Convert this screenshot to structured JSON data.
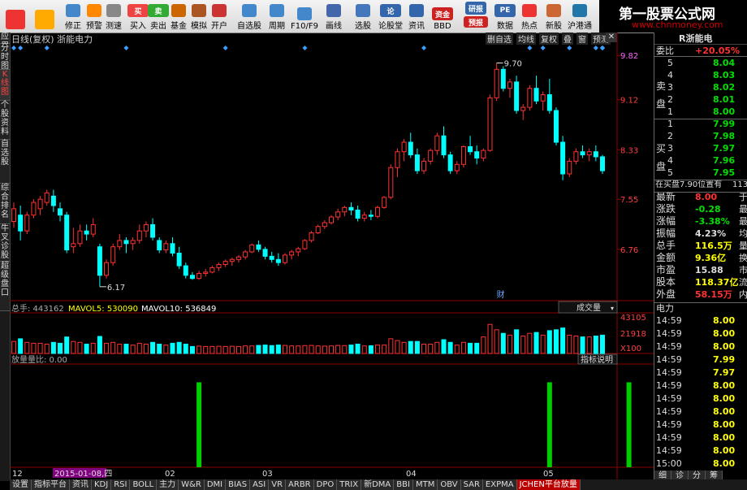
{
  "toolbar": {
    "buttons": [
      {
        "label": "",
        "icon": "grid-icon"
      },
      {
        "label": "",
        "icon": "back-arrow-icon"
      },
      {
        "label": "修正",
        "icon": "up-down-icon"
      },
      {
        "label": "预警",
        "icon": "alarm-icon"
      },
      {
        "label": "测速",
        "icon": "clock-icon"
      },
      {
        "label": "买入",
        "icon": "buy-icon",
        "glyph": "买"
      },
      {
        "label": "卖出",
        "icon": "sell-icon",
        "glyph": "卖"
      },
      {
        "label": "基金",
        "icon": "fund-icon"
      },
      {
        "label": "模拟",
        "icon": "gavel-icon"
      },
      {
        "label": "开户",
        "icon": "account-icon"
      },
      {
        "label": "自选股",
        "icon": "portfolio-icon"
      },
      {
        "label": "周期",
        "icon": "period-icon"
      },
      {
        "label": "F10/F9",
        "icon": "f10-icon"
      },
      {
        "label": "画线",
        "icon": "pen-icon"
      },
      {
        "label": "选股",
        "icon": "select-icon"
      },
      {
        "label": "论股堂",
        "icon": "forum-icon",
        "glyph": "论"
      },
      {
        "label": "资讯",
        "icon": "news-icon"
      },
      {
        "label": "BBD",
        "icon": "fund-flow-icon",
        "glyph": "资金"
      },
      {
        "label": "",
        "icon": "research-icon",
        "glyph": "研报"
      },
      {
        "label": "",
        "icon": "limit-icon",
        "glyph": "预报"
      },
      {
        "label": "数据",
        "icon": "pe-icon",
        "glyph": "PE"
      },
      {
        "label": "热点",
        "icon": "hot-icon"
      },
      {
        "label": "新股",
        "icon": "new-stock-icon"
      },
      {
        "label": "沪港通",
        "icon": "hk-connect-icon"
      }
    ]
  },
  "brand": {
    "title": "第一股票公式网",
    "url": "www.chnmoney.com"
  },
  "left_tabs": [
    "应用",
    "分时图",
    "K线图",
    "个股资料",
    "自选股",
    "综合排名",
    "牛叉诊股",
    "超级盘口"
  ],
  "chart": {
    "title": "日线(复权) 浙能电力",
    "header_buttons": [
      "删自选",
      "均线",
      "复权",
      "叠",
      "窗",
      "预测"
    ],
    "close_glyph": "✕",
    "price_labels": [
      "9.82",
      "9.12",
      "8.33",
      "7.55",
      "6.76"
    ],
    "high_label": "9.70",
    "low_label": "6.17",
    "event_label": "财",
    "candles": [
      [
        7.2,
        7.5,
        7.1,
        7.4
      ],
      [
        7.3,
        7.45,
        6.9,
        7.05
      ],
      [
        7.05,
        7.35,
        7.0,
        7.3
      ],
      [
        7.3,
        7.55,
        7.25,
        7.5
      ],
      [
        7.4,
        7.6,
        7.3,
        7.55
      ],
      [
        7.5,
        7.7,
        7.45,
        7.65
      ],
      [
        7.6,
        7.7,
        7.35,
        7.45
      ],
      [
        7.4,
        7.5,
        7.2,
        7.3
      ],
      [
        7.3,
        7.35,
        6.7,
        6.75
      ],
      [
        6.8,
        7.1,
        6.7,
        6.85
      ],
      [
        6.85,
        7.15,
        6.8,
        7.05
      ],
      [
        7.05,
        7.15,
        6.9,
        7.0
      ],
      [
        7.0,
        7.25,
        6.95,
        7.15
      ],
      [
        6.8,
        6.85,
        6.17,
        6.35
      ],
      [
        6.35,
        6.6,
        6.3,
        6.55
      ],
      [
        6.55,
        6.85,
        6.5,
        6.8
      ],
      [
        6.8,
        7.0,
        6.75,
        6.9
      ],
      [
        6.9,
        6.95,
        6.7,
        6.85
      ],
      [
        6.85,
        6.95,
        6.75,
        6.9
      ],
      [
        6.9,
        7.15,
        6.85,
        7.05
      ],
      [
        7.05,
        7.2,
        6.95,
        7.15
      ],
      [
        7.15,
        7.25,
        6.9,
        6.95
      ],
      [
        6.9,
        6.95,
        6.7,
        6.75
      ],
      [
        6.75,
        6.9,
        6.7,
        6.85
      ],
      [
        6.85,
        6.95,
        6.65,
        6.7
      ],
      [
        6.7,
        6.8,
        6.45,
        6.5
      ],
      [
        6.5,
        6.55,
        6.3,
        6.35
      ],
      [
        6.35,
        6.4,
        6.28,
        6.3
      ],
      [
        6.3,
        6.42,
        6.28,
        6.38
      ],
      [
        6.38,
        6.45,
        6.33,
        6.4
      ],
      [
        6.4,
        6.5,
        6.38,
        6.47
      ],
      [
        6.47,
        6.55,
        6.42,
        6.52
      ],
      [
        6.52,
        6.6,
        6.48,
        6.57
      ],
      [
        6.57,
        6.63,
        6.5,
        6.6
      ],
      [
        6.6,
        6.67,
        6.55,
        6.64
      ],
      [
        6.64,
        6.75,
        6.6,
        6.72
      ],
      [
        6.72,
        6.85,
        6.7,
        6.83
      ],
      [
        6.83,
        6.9,
        6.72,
        6.76
      ],
      [
        6.76,
        6.8,
        6.6,
        6.65
      ],
      [
        6.65,
        6.72,
        6.55,
        6.6
      ],
      [
        6.6,
        6.7,
        6.5,
        6.55
      ],
      [
        6.55,
        6.7,
        6.52,
        6.67
      ],
      [
        6.67,
        6.75,
        6.6,
        6.72
      ],
      [
        6.72,
        6.8,
        6.65,
        6.77
      ],
      [
        6.77,
        6.92,
        6.75,
        6.9
      ],
      [
        6.9,
        7.05,
        6.87,
        7.02
      ],
      [
        7.02,
        7.15,
        7.0,
        7.12
      ],
      [
        7.12,
        7.22,
        7.08,
        7.18
      ],
      [
        7.18,
        7.3,
        7.15,
        7.27
      ],
      [
        7.27,
        7.4,
        7.22,
        7.35
      ],
      [
        7.35,
        7.45,
        7.28,
        7.42
      ],
      [
        7.42,
        7.5,
        7.3,
        7.38
      ],
      [
        7.38,
        7.45,
        7.2,
        7.25
      ],
      [
        7.25,
        7.35,
        7.2,
        7.3
      ],
      [
        7.3,
        7.38,
        7.22,
        7.28
      ],
      [
        7.28,
        7.45,
        7.25,
        7.42
      ],
      [
        7.42,
        7.6,
        7.4,
        7.58
      ],
      [
        7.58,
        8.1,
        7.55,
        8.05
      ],
      [
        8.05,
        8.35,
        7.9,
        8.3
      ],
      [
        8.3,
        8.5,
        8.15,
        8.45
      ],
      [
        8.45,
        8.6,
        8.2,
        8.25
      ],
      [
        8.25,
        8.35,
        7.95,
        8.0
      ],
      [
        8.0,
        8.2,
        7.95,
        8.15
      ],
      [
        8.15,
        8.35,
        8.1,
        8.32
      ],
      [
        8.32,
        8.6,
        8.25,
        8.55
      ],
      [
        8.55,
        8.7,
        8.2,
        8.25
      ],
      [
        8.25,
        8.3,
        7.95,
        8.0
      ],
      [
        8.0,
        8.15,
        7.95,
        8.1
      ],
      [
        8.1,
        8.4,
        8.05,
        8.38
      ],
      [
        8.38,
        8.55,
        8.25,
        8.3
      ],
      [
        8.3,
        8.4,
        8.1,
        8.2
      ],
      [
        8.2,
        8.35,
        8.15,
        8.32
      ],
      [
        8.32,
        9.2,
        8.3,
        9.15
      ],
      [
        9.15,
        9.7,
        9.1,
        9.6
      ],
      [
        9.6,
        9.65,
        9.25,
        9.3
      ],
      [
        9.3,
        9.45,
        9.15,
        9.4
      ],
      [
        9.4,
        9.5,
        8.9,
        8.95
      ],
      [
        8.95,
        9.05,
        8.8,
        9.0
      ],
      [
        9.0,
        9.35,
        8.95,
        9.3
      ],
      [
        9.3,
        9.5,
        9.05,
        9.1
      ],
      [
        9.1,
        9.25,
        8.95,
        9.2
      ],
      [
        9.2,
        9.45,
        8.9,
        8.95
      ],
      [
        8.95,
        9.0,
        8.4,
        8.45
      ],
      [
        8.45,
        8.55,
        7.85,
        7.95
      ],
      [
        7.95,
        8.2,
        7.9,
        8.15
      ],
      [
        8.15,
        8.35,
        8.1,
        8.3
      ],
      [
        8.3,
        8.4,
        8.2,
        8.25
      ],
      [
        8.25,
        8.35,
        8.15,
        8.3
      ],
      [
        8.3,
        8.4,
        8.15,
        8.22
      ],
      [
        8.22,
        8.25,
        7.95,
        8.0
      ]
    ],
    "volume": {
      "label_main": "总手: 443162",
      "label_ma5": "MAVOL5: 530090",
      "label_ma10": "MAVOL10: 536849",
      "dropdown": "成交量",
      "axis_labels": [
        "43105",
        "21918",
        "X100"
      ]
    },
    "indicator": {
      "label": "放量量比: 0.00",
      "button": "指标说明",
      "spikes": [
        {
          "i": 28,
          "v": 1.0
        },
        {
          "i": 81,
          "v": 1.0
        },
        {
          "i": 93,
          "v": 1.0
        }
      ]
    },
    "date_labels": [
      "12",
      "2015-01-08,四",
      "02",
      "03",
      "04",
      "05"
    ]
  },
  "right_panel": {
    "name": "R浙能电",
    "weibi_label": "委比",
    "weibi_value": "+20.05%",
    "sell_label": "卖盘",
    "sells": [
      [
        "5",
        "8.04"
      ],
      [
        "4",
        "8.03"
      ],
      [
        "3",
        "8.02"
      ],
      [
        "2",
        "8.01"
      ],
      [
        "1",
        "8.00"
      ]
    ],
    "buy_label": "买盘",
    "buys": [
      [
        "1",
        "7.99"
      ],
      [
        "2",
        "7.98"
      ],
      [
        "3",
        "7.97"
      ],
      [
        "4",
        "7.96"
      ],
      [
        "5",
        "7.95"
      ]
    ],
    "position_line": "在买盘7.90位置有",
    "position_suffix": "113",
    "stats": [
      {
        "k": "最新",
        "v": "8.00",
        "s": "于",
        "c": "red"
      },
      {
        "k": "涨跌",
        "v": "-0.28",
        "s": "最",
        "c": "grn"
      },
      {
        "k": "涨幅",
        "v": "-3.38%",
        "s": "最",
        "c": "grn"
      },
      {
        "k": "振幅",
        "v": "4.23%",
        "s": "均",
        "c": "wht"
      },
      {
        "k": "总手",
        "v": "116.5万",
        "s": "量",
        "c": "yel"
      },
      {
        "k": "金额",
        "v": "9.36亿",
        "s": "换",
        "c": "yel"
      },
      {
        "k": "市盈",
        "v": "15.88",
        "s": "市",
        "c": "wht"
      },
      {
        "k": "股本",
        "v": "118.37亿",
        "s": "流",
        "c": "yel"
      },
      {
        "k": "外盘",
        "v": "58.15万",
        "s": "内",
        "c": "red"
      }
    ],
    "ticks_header": "电力",
    "ticks": [
      [
        "14:59",
        "8.00"
      ],
      [
        "14:59",
        "8.00"
      ],
      [
        "14:59",
        "8.00"
      ],
      [
        "14:59",
        "7.99"
      ],
      [
        "14:59",
        "7.97"
      ],
      [
        "14:59",
        "8.00"
      ],
      [
        "14:59",
        "8.00"
      ],
      [
        "14:59",
        "8.00"
      ],
      [
        "14:59",
        "8.00"
      ],
      [
        "14:59",
        "8.00"
      ],
      [
        "14:59",
        "8.00"
      ],
      [
        "15:00",
        "8.00"
      ]
    ],
    "bottom_tabs": [
      "细",
      "诊",
      "分",
      "筹"
    ]
  },
  "bottom_tabs": [
    "设置",
    "指标平台",
    "资讯",
    "KDJ",
    "RSI",
    "BOLL",
    "主力",
    "W&R",
    "DMI",
    "BIAS",
    "ASI",
    "VR",
    "ARBR",
    "DPO",
    "TRIX",
    "新DMA",
    "BBI",
    "MTM",
    "OBV",
    "SAR",
    "EXPMA",
    "JCHEN平台放量"
  ],
  "bottom_active": "JCHEN平台放量",
  "colors": {
    "up": "#ff3232",
    "down": "#00ffff",
    "spike": "#00cc00",
    "bg": "#000000",
    "grid": "#8b0000"
  }
}
